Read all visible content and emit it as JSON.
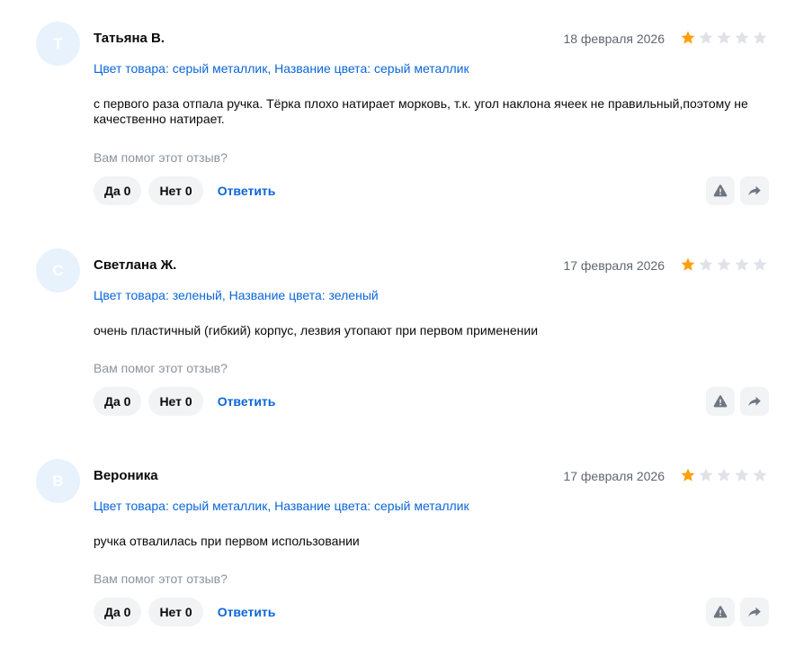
{
  "reviews": [
    {
      "avatar_letter": "Т",
      "author": "Татьяна В.",
      "date": "18 февраля 2026",
      "rating": 1,
      "max_rating": 5,
      "variant": "Цвет товара: серый металлик, Название цвета: серый металлик",
      "text": "с первого раза отпала ручка. Тёрка плохо натирает морковь, т.к. угол наклона ячеек не правильный,поэтому не качественно натирает.",
      "helpful_question": "Вам помог этот отзыв?",
      "yes_label": "Да 0",
      "no_label": "Нет 0",
      "reply_label": "Ответить"
    },
    {
      "avatar_letter": "С",
      "author": "Светлана Ж.",
      "date": "17 февраля 2026",
      "rating": 1,
      "max_rating": 5,
      "variant": "Цвет товара: зеленый, Название цвета: зеленый",
      "text": "очень пластичный (гибкий) корпус, лезвия утопают при первом применении",
      "helpful_question": "Вам помог этот отзыв?",
      "yes_label": "Да 0",
      "no_label": "Нет 0",
      "reply_label": "Ответить"
    },
    {
      "avatar_letter": "В",
      "author": "Вероника",
      "date": "17 февраля 2026",
      "rating": 1,
      "max_rating": 5,
      "variant": "Цвет товара: серый металлик, Название цвета: серый металлик",
      "text": "ручка отвалилась при первом использовании",
      "helpful_question": "Вам помог этот отзыв?",
      "yes_label": "Да 0",
      "no_label": "Нет 0",
      "reply_label": "Ответить"
    }
  ],
  "icons": {
    "report": "warning-triangle-icon",
    "share": "share-arrow-icon",
    "star": "star-icon"
  },
  "colors": {
    "link": "#0b66d8",
    "star_filled": "#ff9f0a",
    "star_empty": "#dfe2e6",
    "chip_bg": "#f2f3f5",
    "muted_text": "#8b939d",
    "avatar_bg": "#e8f2fd"
  }
}
